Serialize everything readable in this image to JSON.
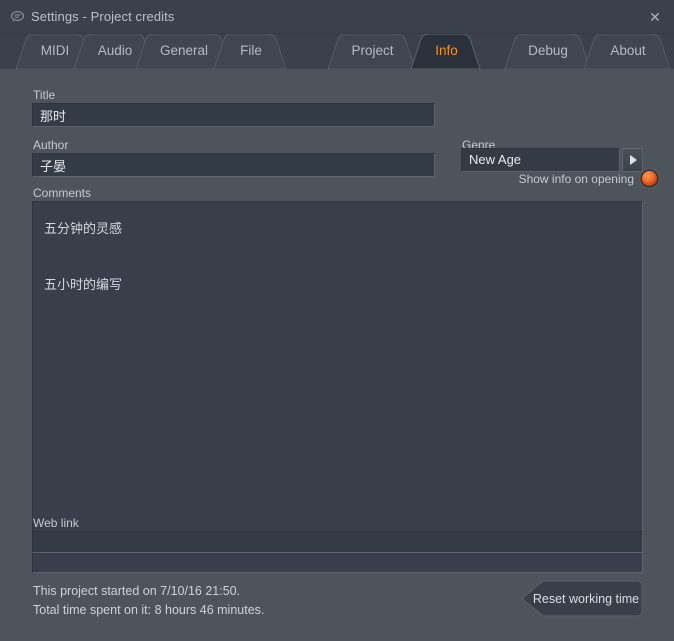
{
  "window": {
    "title": "Settings - Project credits",
    "icon": "comment-bubble-icon",
    "close_label": "✕"
  },
  "tabs": [
    {
      "id": "midi",
      "label": "MIDI",
      "active": false
    },
    {
      "id": "audio",
      "label": "Audio",
      "active": false
    },
    {
      "id": "general",
      "label": "General",
      "active": false
    },
    {
      "id": "file",
      "label": "File",
      "active": false
    },
    {
      "id": "project",
      "label": "Project",
      "active": false
    },
    {
      "id": "info",
      "label": "Info",
      "active": true
    },
    {
      "id": "debug",
      "label": "Debug",
      "active": false
    },
    {
      "id": "about",
      "label": "About",
      "active": false
    }
  ],
  "form": {
    "title_label": "Title",
    "title_value": "那时",
    "title_placeholder": "",
    "author_label": "Author",
    "author_value": "子晏",
    "author_placeholder": "",
    "comments_label": "Comments",
    "comments_value": "五分钟的灵感\n\n五小时的编写",
    "comments_placeholder": "",
    "weblink_label": "Web link",
    "weblink_value": "",
    "weblink_placeholder": "",
    "show_info_label": "Show info on opening",
    "show_info_on": true,
    "genre_label": "Genre",
    "genre_value": "New Age",
    "genre_arrow_icon": "triangle-right-icon"
  },
  "footer": {
    "started_line": "This project started on 7/10/16 21:50.",
    "total_line": "Total time spent on it: 8 hours 46 minutes.",
    "reset_button_label": "Reset working time"
  },
  "colors": {
    "window_bg": "#4d545c",
    "titlebar_bg": "#3a414b",
    "input_bg": "#333b45",
    "textarea_bg": "#383f4a",
    "accent": "#f79413",
    "led": "#f06a24",
    "text": "#c3cad1"
  }
}
